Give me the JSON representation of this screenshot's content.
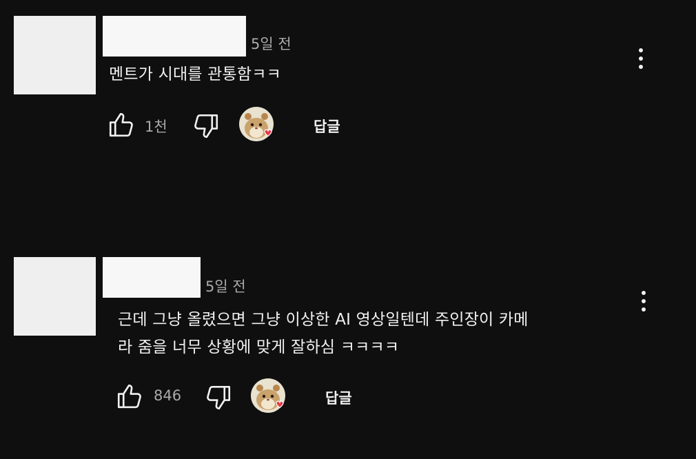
{
  "comments": [
    {
      "timestamp": "5일 전",
      "text_lines": [
        "멘트가 시대를 관통함ㅋㅋ"
      ],
      "like_count": "1천",
      "reply_label": "답글"
    },
    {
      "timestamp": "5일 전",
      "text_lines": [
        "근데 그냥 올렸으면 그냥 이상한 AI 영상일텐데 주인장이 카메",
        "라 줌을 너무 상황에 맞게 잘하심 ㅋㅋㅋㅋ"
      ],
      "like_count": "846",
      "reply_label": "답글"
    }
  ],
  "icons": {
    "like": "thumbs-up-icon",
    "dislike": "thumbs-down-icon",
    "menu": "more-vert-icon",
    "creator_avatar": "hamster-avatar",
    "heart": "heart-icon"
  },
  "colors": {
    "background": "#0f0f0f",
    "heart": "#e53948",
    "text": "#f1f1f1",
    "muted": "#aaaaaa"
  }
}
